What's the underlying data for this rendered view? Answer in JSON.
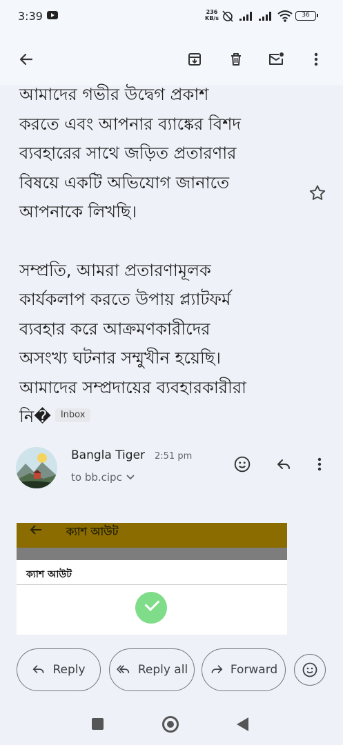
{
  "status_bar": {
    "time": "3:39",
    "net_speed_value": "236",
    "net_speed_unit": "KB/s",
    "battery": "36"
  },
  "toolbar": {
    "back_icon": "arrow-back-icon",
    "archive_icon": "archive-icon",
    "delete_icon": "trash-icon",
    "mark_unread_icon": "mail-unread-icon",
    "more_icon": "more-vert-icon"
  },
  "email": {
    "body_lines_p1": [
      "আমাদের গভীর উদ্বেগ প্রকাশ",
      "করতে এবং আপনার ব্যাঙ্কের বিশদ",
      "ব্যবহারের সাথে জড়িত প্রতারণার",
      "বিষয়ে একটি অভিযোগ জানাতে",
      "আপনাকে লিখছি।"
    ],
    "body_lines_p2": [
      "সম্প্রতি, আমরা প্রতারণামূলক",
      "কার্যকলাপ করতে উপায় প্ল্যাটফর্ম",
      "ব্যবহার করে আক্রমণকারীদের",
      "অসংখ্য ঘটনার সম্মুখীন হয়েছি।",
      "আমাদের সম্প্রদায়ের ব্যবহারকারীরা"
    ],
    "body_last_line": "নি�",
    "label_chip": "Inbox"
  },
  "message": {
    "sender_name": "Bangla Tiger",
    "time": "2:51 pm",
    "to_line": "to bb.cipc"
  },
  "attachment": {
    "header_title": "ক্যাশ আউট",
    "row_text": "ক্যাশ আউট"
  },
  "actions": {
    "reply_label": "Reply",
    "reply_all_label": "Reply all",
    "forward_label": "Forward"
  },
  "colors": {
    "background": "#eef1f7",
    "attachment_header": "#8a6c00",
    "success_green": "#7fdd8a"
  }
}
